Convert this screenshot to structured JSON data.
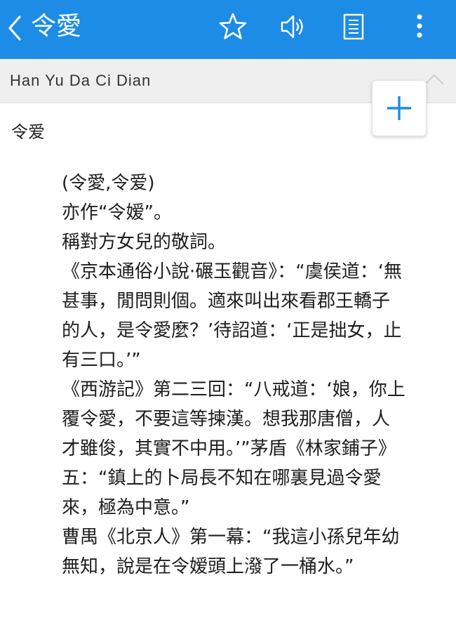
{
  "topbar": {
    "title": "令愛",
    "background": "#1c8ce6",
    "icons": [
      "chevron-left-icon",
      "star-icon",
      "speaker-icon",
      "book-icon",
      "more-vertical-icon"
    ]
  },
  "subheader": {
    "dictionary_name": "Han Yu Da Ci Dian",
    "icons": [
      "chevron-up-icon",
      "plus-icon"
    ]
  },
  "entry": {
    "headword": "令爱",
    "lines": [
      "(令愛,令爱)",
      "亦作“令嫒”。",
      "稱對方女兒的敬詞。",
      "《京本通俗小說·碾玉觀音》：“虞侯道：‘無",
      "甚事，閒問則個。適來叫出來看郡王轎子",
      "的人，是令愛麼？’待詔道：‘正是拙女，止",
      "有三口。’”",
      "《西游記》第二三回：“八戒道：‘娘，你上",
      "覆令愛，不要這等揀漢。想我那唐僧，人",
      "才雖俊，其實不中用。’”茅盾《林家鋪子》",
      "五：“鎮上的卜局長不知在哪裏見過令愛",
      "來，極為中意。”",
      "曹禺《北京人》第一幕：“我這小孫兒年幼",
      "無知，說是在令嫒頭上潑了一桶水。”"
    ]
  }
}
